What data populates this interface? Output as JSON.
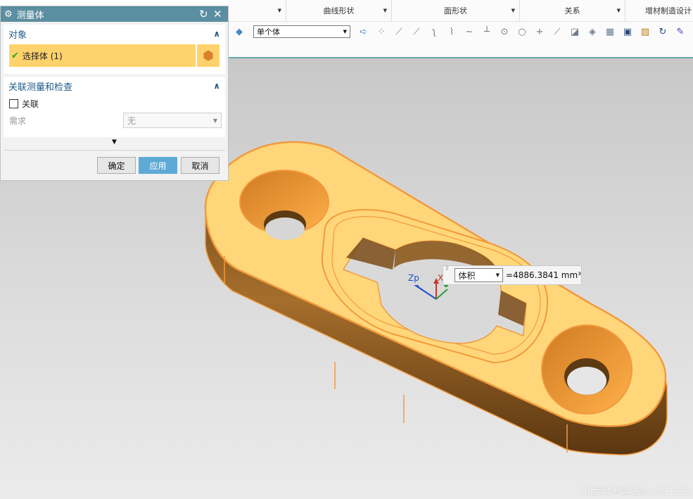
{
  "ribbon": {
    "groups": [
      {
        "label": ""
      },
      {
        "label": "曲线形状"
      },
      {
        "label": "面形状"
      },
      {
        "label": "关系"
      },
      {
        "label": "增材制造设计"
      }
    ]
  },
  "toolbar": {
    "filter_value": "单个体"
  },
  "dialog": {
    "title": "测量体",
    "objects_section": "对象",
    "select_body_label": "选择体 (1)",
    "assoc_section": "关联测量和检查",
    "associative_label": "关联",
    "requirement_label": "需求",
    "requirement_value": "无",
    "ok_label": "确定",
    "apply_label": "应用",
    "cancel_label": "取消"
  },
  "viewport": {
    "axis_label": "Zp",
    "axis_x_label": "X"
  },
  "measurement": {
    "type": "体积",
    "value": "=4886.3841 mm³"
  },
  "watermark": "UG爱好者论坛@he851215",
  "colors": {
    "title_bar": "#5b8ea0",
    "selection_highlight": "#ffd36b",
    "part_face": "#ffd77a",
    "part_wall": "#8a5a22",
    "part_edge": "#f29a3c",
    "apply_button": "#5ea9d6"
  }
}
